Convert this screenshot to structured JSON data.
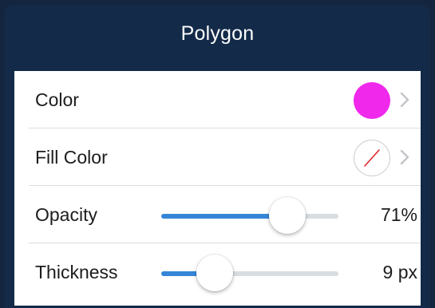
{
  "header": {
    "title": "Polygon"
  },
  "rows": {
    "color": {
      "label": "Color",
      "swatch_color": "#f028eb"
    },
    "fill_color": {
      "label": "Fill Color",
      "swatch_state": "none"
    },
    "opacity": {
      "label": "Opacity",
      "value_text": "71%",
      "level": 0.71
    },
    "thickness": {
      "label": "Thickness",
      "value_text": "9 px",
      "level": 0.3
    }
  },
  "colors": {
    "header_bg": "#132a48",
    "accent": "#3586d8",
    "track": "#d8dde2",
    "no_color_slash": "#e0242a"
  },
  "icons": {
    "chevron": "chevron-right-icon",
    "no_color": "no-color-slash-icon"
  }
}
